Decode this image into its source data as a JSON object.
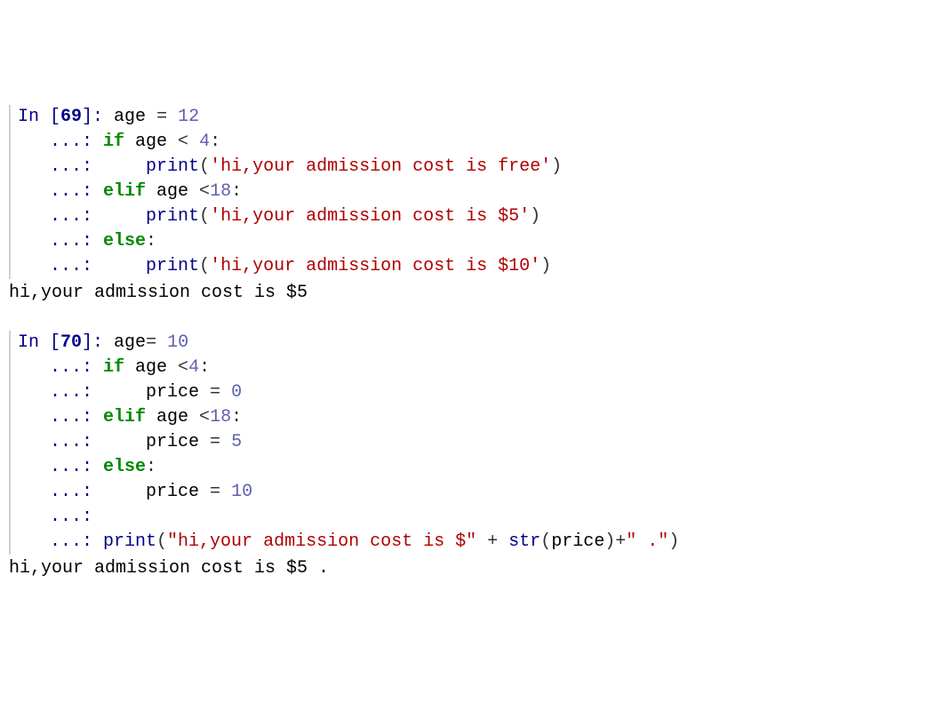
{
  "cells": [
    {
      "prompt_num": "69",
      "lines": [
        {
          "prefix": "In [",
          "prefix2": "69",
          "prefix3": "]: ",
          "tokens": [
            {
              "t": "name",
              "v": "age"
            },
            {
              "t": "op",
              "v": " = "
            },
            {
              "t": "num",
              "v": "12"
            }
          ]
        },
        {
          "prefix": "   ...: ",
          "tokens": [
            {
              "t": "kw",
              "v": "if"
            },
            {
              "t": "name",
              "v": " age "
            },
            {
              "t": "op",
              "v": "<"
            },
            {
              "t": "name",
              "v": " "
            },
            {
              "t": "num",
              "v": "4"
            },
            {
              "t": "op",
              "v": ":"
            }
          ]
        },
        {
          "prefix": "   ...: ",
          "tokens": [
            {
              "t": "name",
              "v": "    "
            },
            {
              "t": "fn",
              "v": "print"
            },
            {
              "t": "op",
              "v": "("
            },
            {
              "t": "str",
              "v": "'hi,your admission cost is free'"
            },
            {
              "t": "op",
              "v": ")"
            }
          ]
        },
        {
          "prefix": "   ...: ",
          "tokens": [
            {
              "t": "kw",
              "v": "elif"
            },
            {
              "t": "name",
              "v": " age "
            },
            {
              "t": "op",
              "v": "<"
            },
            {
              "t": "num",
              "v": "18"
            },
            {
              "t": "op",
              "v": ":"
            }
          ]
        },
        {
          "prefix": "   ...: ",
          "tokens": [
            {
              "t": "name",
              "v": "    "
            },
            {
              "t": "fn",
              "v": "print"
            },
            {
              "t": "op",
              "v": "("
            },
            {
              "t": "str",
              "v": "'hi,your admission cost is $5'"
            },
            {
              "t": "op",
              "v": ")"
            }
          ]
        },
        {
          "prefix": "   ...: ",
          "tokens": [
            {
              "t": "kw",
              "v": "else"
            },
            {
              "t": "op",
              "v": ":"
            }
          ]
        },
        {
          "prefix": "   ...: ",
          "tokens": [
            {
              "t": "name",
              "v": "    "
            },
            {
              "t": "fn",
              "v": "print"
            },
            {
              "t": "op",
              "v": "("
            },
            {
              "t": "str",
              "v": "'hi,your admission cost is $10'"
            },
            {
              "t": "op",
              "v": ")"
            }
          ]
        }
      ],
      "output": "hi,your admission cost is $5"
    },
    {
      "prompt_num": "70",
      "lines": [
        {
          "prefix": "In [",
          "prefix2": "70",
          "prefix3": "]: ",
          "tokens": [
            {
              "t": "name",
              "v": "age"
            },
            {
              "t": "op",
              "v": "= "
            },
            {
              "t": "num",
              "v": "10"
            }
          ]
        },
        {
          "prefix": "   ...: ",
          "tokens": [
            {
              "t": "kw",
              "v": "if"
            },
            {
              "t": "name",
              "v": " age "
            },
            {
              "t": "op",
              "v": "<"
            },
            {
              "t": "num",
              "v": "4"
            },
            {
              "t": "op",
              "v": ":"
            }
          ]
        },
        {
          "prefix": "   ...: ",
          "tokens": [
            {
              "t": "name",
              "v": "    price "
            },
            {
              "t": "op",
              "v": "= "
            },
            {
              "t": "num",
              "v": "0"
            }
          ]
        },
        {
          "prefix": "   ...: ",
          "tokens": [
            {
              "t": "kw",
              "v": "elif"
            },
            {
              "t": "name",
              "v": " age "
            },
            {
              "t": "op",
              "v": "<"
            },
            {
              "t": "num",
              "v": "18"
            },
            {
              "t": "op",
              "v": ":"
            }
          ]
        },
        {
          "prefix": "   ...: ",
          "tokens": [
            {
              "t": "name",
              "v": "    price "
            },
            {
              "t": "op",
              "v": "= "
            },
            {
              "t": "num",
              "v": "5"
            }
          ]
        },
        {
          "prefix": "   ...: ",
          "tokens": [
            {
              "t": "kw",
              "v": "else"
            },
            {
              "t": "op",
              "v": ":"
            }
          ]
        },
        {
          "prefix": "   ...: ",
          "tokens": [
            {
              "t": "name",
              "v": "    price "
            },
            {
              "t": "op",
              "v": "= "
            },
            {
              "t": "num",
              "v": "10"
            }
          ]
        },
        {
          "prefix": "   ...: ",
          "tokens": []
        },
        {
          "prefix": "   ...: ",
          "tokens": [
            {
              "t": "fn",
              "v": "print"
            },
            {
              "t": "op",
              "v": "("
            },
            {
              "t": "str",
              "v": "\"hi,your admission cost is $\""
            },
            {
              "t": "name",
              "v": " "
            },
            {
              "t": "op",
              "v": "+"
            },
            {
              "t": "name",
              "v": " "
            },
            {
              "t": "fn",
              "v": "str"
            },
            {
              "t": "op",
              "v": "("
            },
            {
              "t": "name",
              "v": "price"
            },
            {
              "t": "op",
              "v": ")"
            },
            {
              "t": "op",
              "v": "+"
            },
            {
              "t": "str",
              "v": "\" .\""
            },
            {
              "t": "op",
              "v": ")"
            }
          ]
        }
      ],
      "output": "hi,your admission cost is $5 ."
    }
  ]
}
